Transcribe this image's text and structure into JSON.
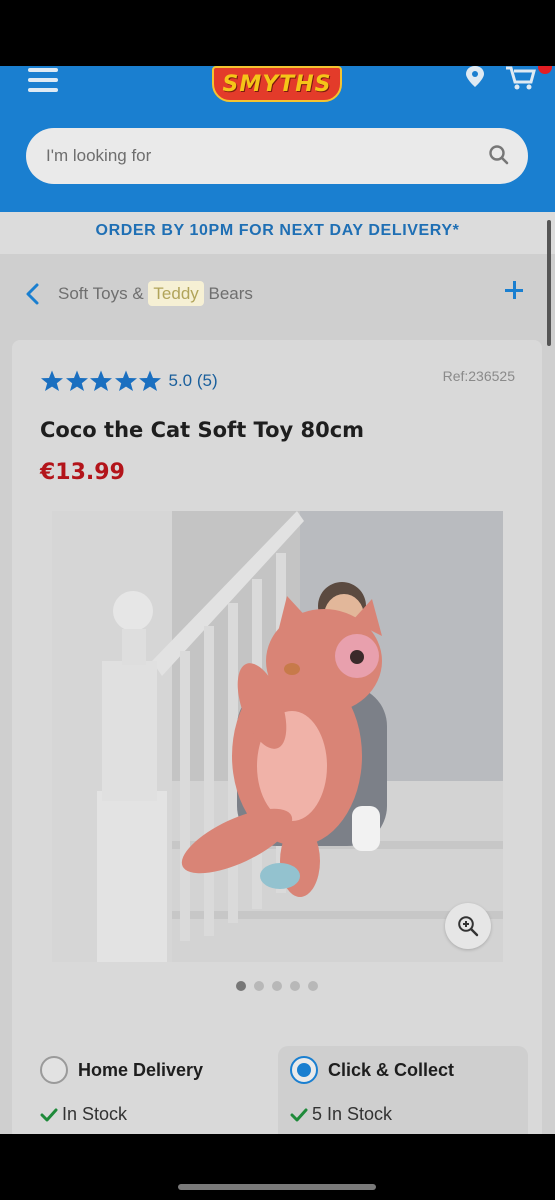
{
  "header": {
    "logo_text": "SMYTHS",
    "brand_color": "#1a7fd0",
    "search_placeholder": "I'm looking for"
  },
  "promo": {
    "text": "ORDER BY 10PM FOR NEXT DAY DELIVERY*"
  },
  "breadcrumb": {
    "prefix": "Soft Toys & ",
    "highlight": "Teddy",
    "suffix": " Bears"
  },
  "product": {
    "rating_text": "5.0 (5)",
    "rating_value": 5.0,
    "stars": 5,
    "ref": "Ref:236525",
    "title": "Coco the Cat Soft Toy 80cm",
    "price": "€13.99",
    "price_color": "#b3141a",
    "image_count": 5,
    "active_image": 1
  },
  "delivery": {
    "home": {
      "label": "Home Delivery",
      "stock": "In Stock",
      "selected": false
    },
    "collect": {
      "label": "Click & Collect",
      "stock": "5 In Stock",
      "selected": true
    }
  },
  "icons": [
    "menu-icon",
    "location-pin-icon",
    "cart-icon",
    "search-icon",
    "chevron-left-icon",
    "plus-icon",
    "star-icon",
    "zoom-in-icon",
    "check-icon"
  ]
}
